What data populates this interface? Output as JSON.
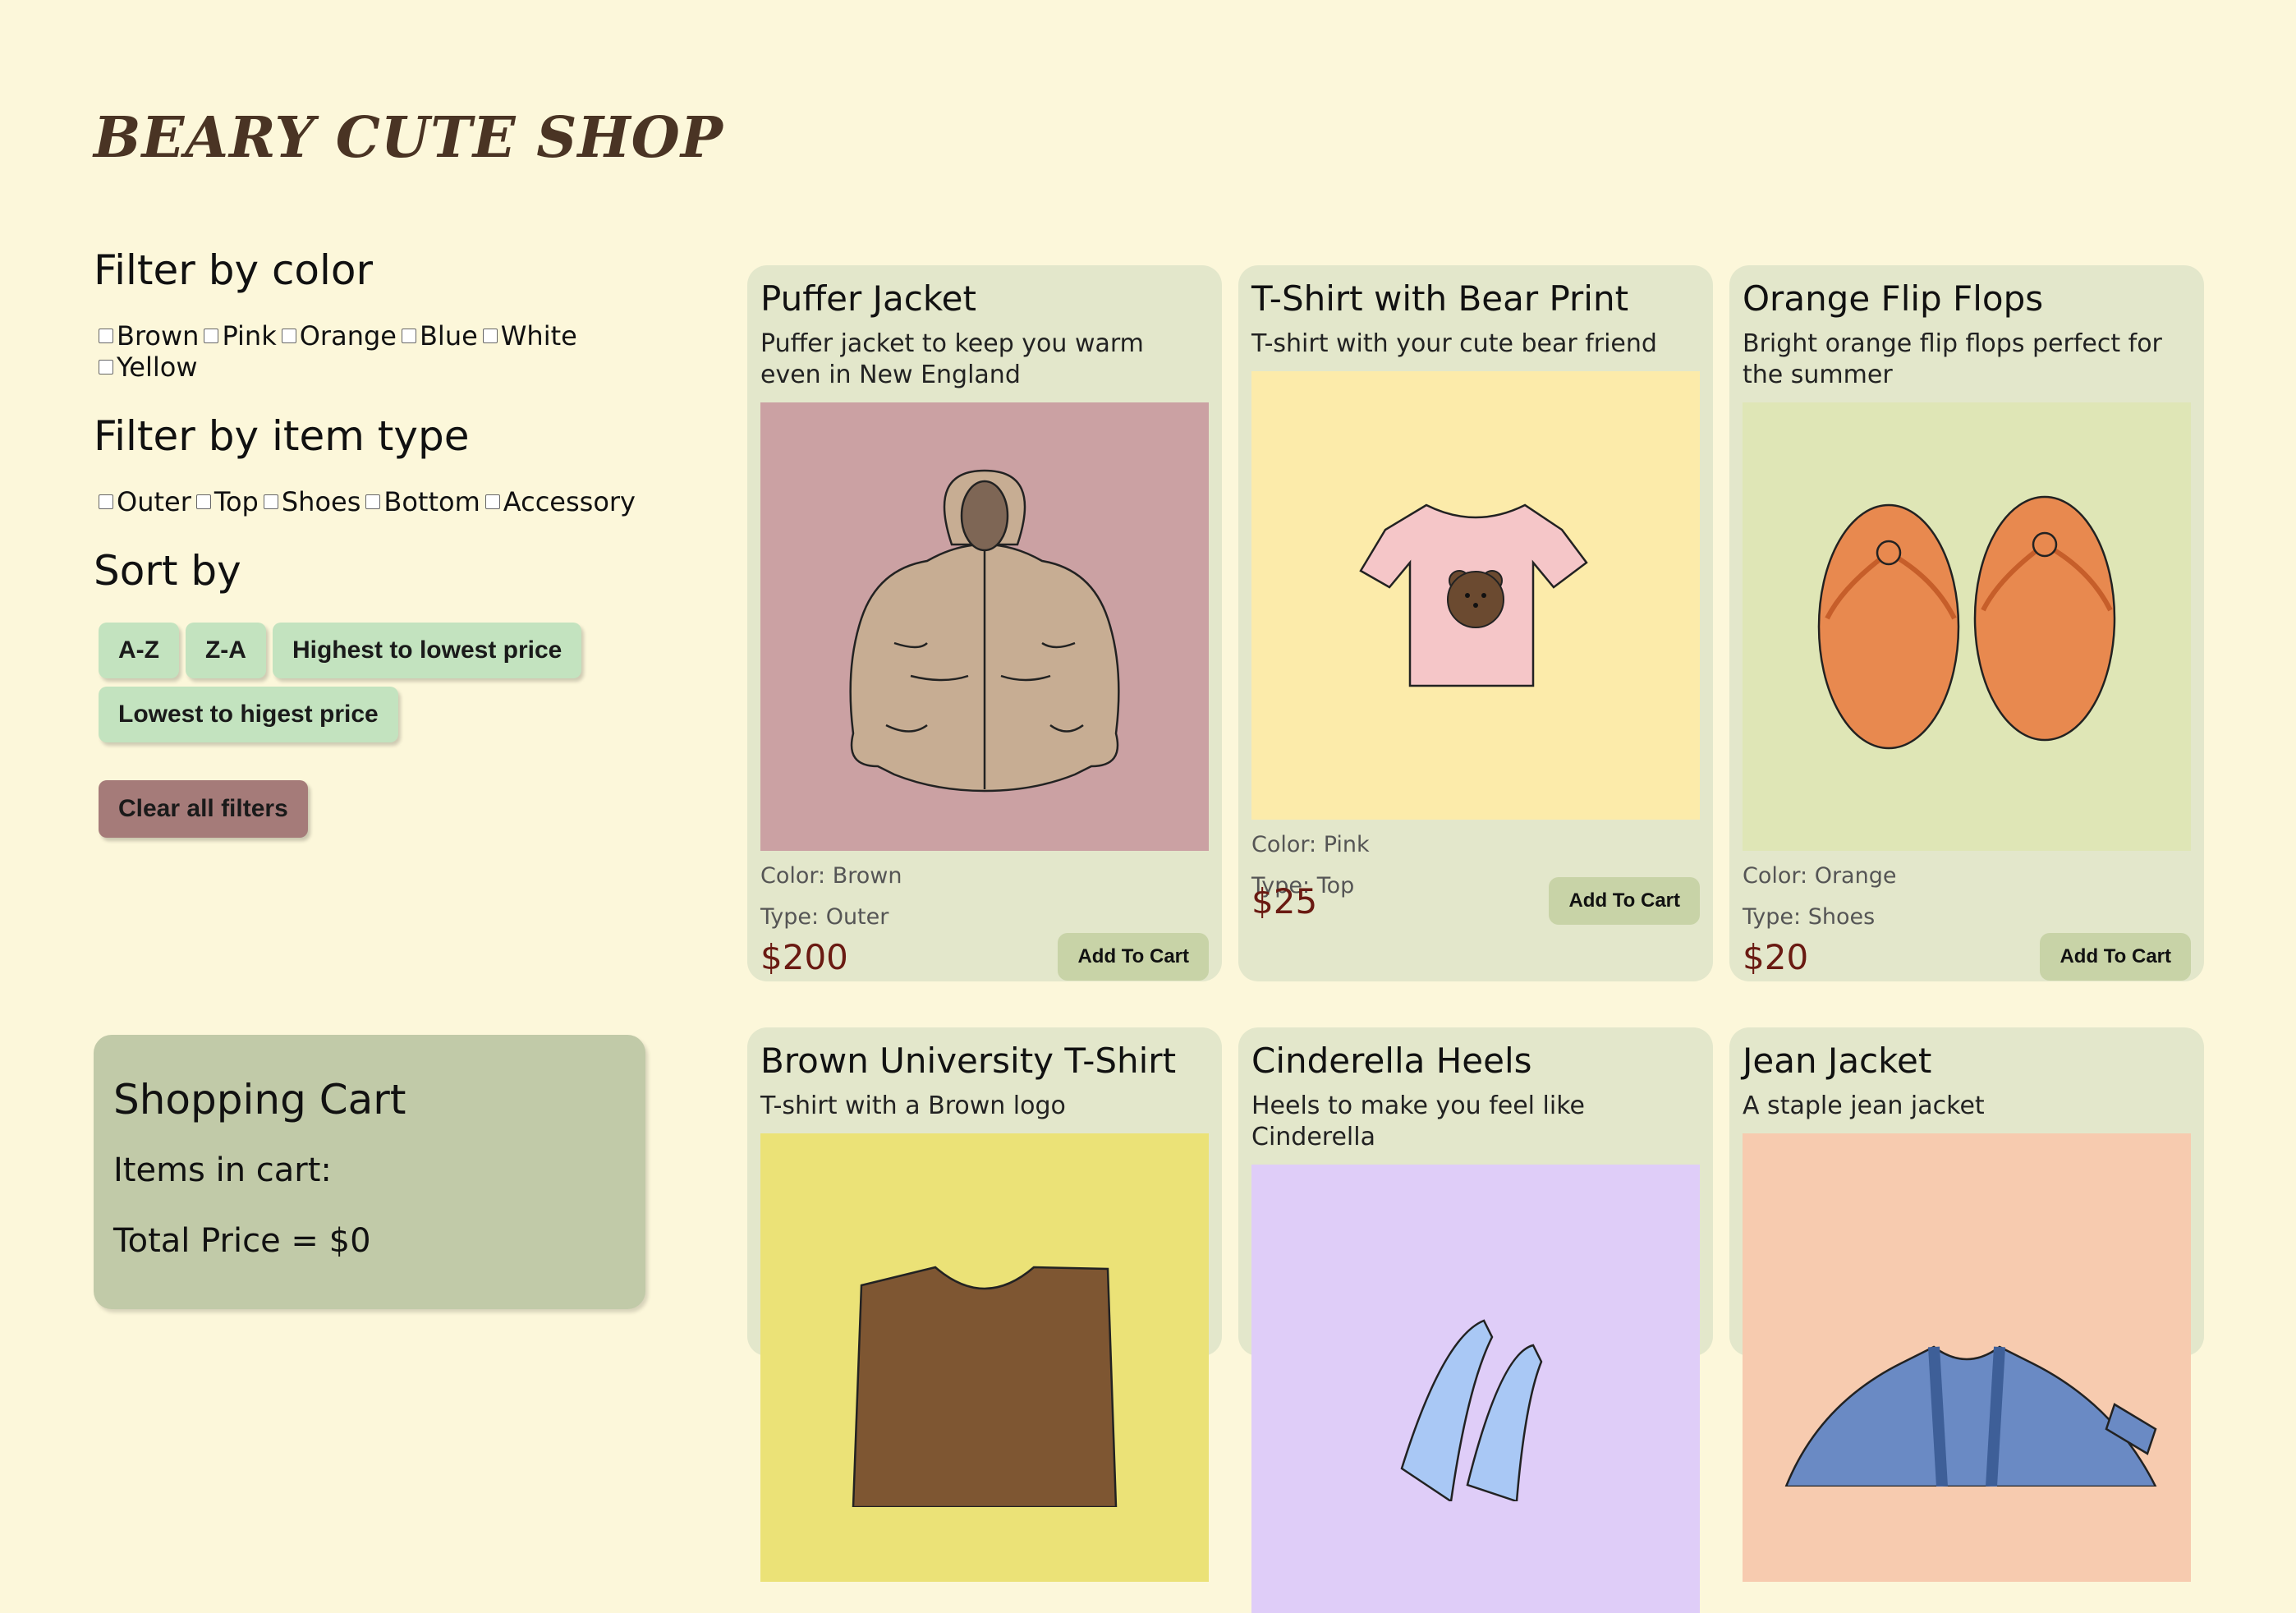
{
  "shop_title": "BEARY CUTE SHOP",
  "filters": {
    "color_heading": "Filter by color",
    "colors": [
      "Brown",
      "Pink",
      "Orange",
      "Blue",
      "White",
      "Yellow"
    ],
    "type_heading": "Filter by item type",
    "types": [
      "Outer",
      "Top",
      "Shoes",
      "Bottom",
      "Accessory"
    ],
    "sort_heading": "Sort by",
    "sort_options": [
      "A-Z",
      "Z-A",
      "Highest to lowest price",
      "Lowest to higest price"
    ],
    "clear_label": "Clear all filters"
  },
  "cart": {
    "title": "Shopping Cart",
    "items_label": "Items in cart:",
    "total_label": "Total Price = $0"
  },
  "products": [
    {
      "name": "Puffer Jacket",
      "desc": "Puffer jacket to keep you warm even in New England",
      "color": "Color: Brown",
      "type": "Type: Outer",
      "price": "$200",
      "button": "Add To Cart",
      "bg": "#cba1a3",
      "icon": "puffer-jacket-icon"
    },
    {
      "name": "T-Shirt with Bear Print",
      "desc": "T-shirt with your cute bear friend",
      "color": "Color: Pink",
      "type": "Type: Top",
      "price": "$25",
      "button": "Add To Cart",
      "bg": "#fcebaa",
      "icon": "bear-tshirt-icon"
    },
    {
      "name": "Orange Flip Flops",
      "desc": "Bright orange flip flops perfect for the summer",
      "color": "Color: Orange",
      "type": "Type: Shoes",
      "price": "$20",
      "button": "Add To Cart",
      "bg": "#dfe6b6",
      "icon": "flip-flops-icon"
    },
    {
      "name": "Brown University T-Shirt",
      "desc": "T-shirt with a Brown logo",
      "bg": "#ebe277",
      "icon": "brown-tshirt-icon"
    },
    {
      "name": "Cinderella Heels",
      "desc": "Heels to make you feel like Cinderella",
      "bg": "#dfcdf8",
      "icon": "heels-icon"
    },
    {
      "name": "Jean Jacket",
      "desc": "A staple jean jacket",
      "bg": "#f7cbaf",
      "icon": "jean-jacket-icon"
    }
  ]
}
